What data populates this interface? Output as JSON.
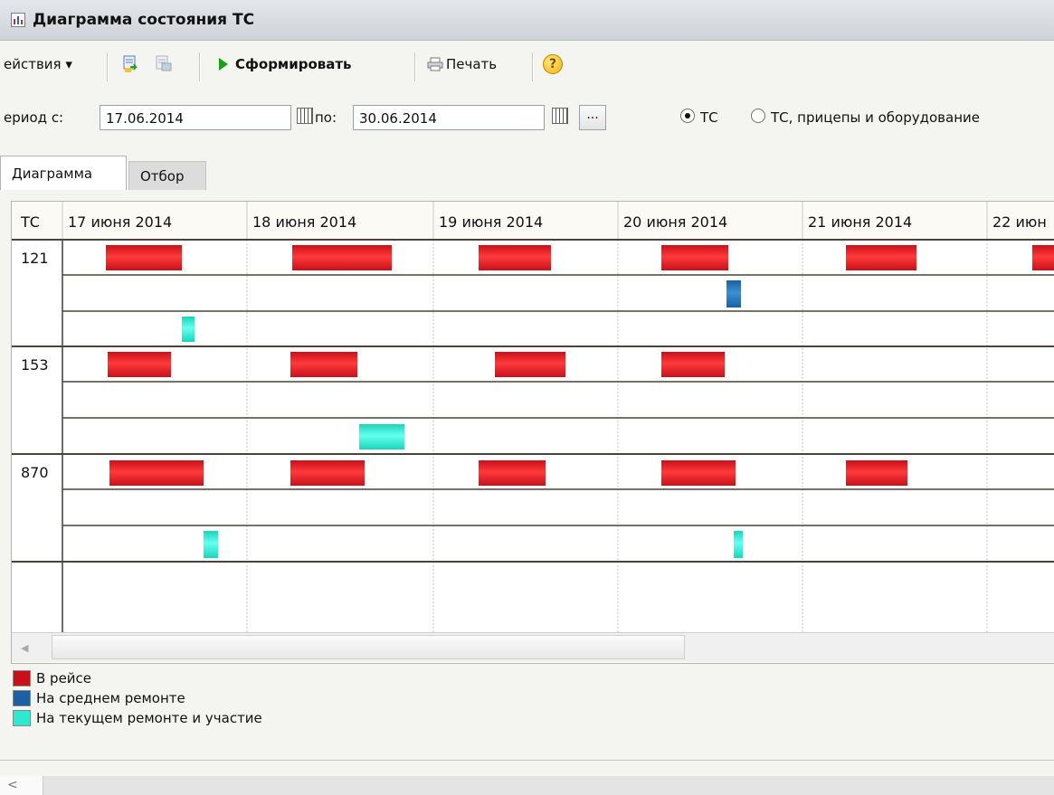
{
  "window": {
    "title": "Диаграмма состояния ТС"
  },
  "toolbar": {
    "actions_label": "ействия ▾",
    "generate_label": "Сформировать",
    "print_label": "Печать",
    "help_label": "?"
  },
  "period": {
    "from_label": "ериод с:",
    "from_value": "17.06.2014",
    "to_label": "по:",
    "to_value": "30.06.2014",
    "more_label": "...",
    "radio_ts_label": "ТС",
    "radio_all_label": "ТС, прицепы и оборудование",
    "radio_selected": "ТС"
  },
  "tabs": [
    {
      "label": "Диаграмма",
      "active": true
    },
    {
      "label": "Отбор",
      "active": false
    }
  ],
  "chart": {
    "ts_header": "ТС",
    "days": [
      "17 июня 2014",
      "18 июня 2014",
      "19 июня 2014",
      "20 июня 2014",
      "21 июня 2014",
      "22 июн"
    ],
    "vehicles": [
      "121",
      "153",
      "870"
    ]
  },
  "legend": [
    {
      "label": "В рейсе",
      "color": "#c8101a"
    },
    {
      "label": "На среднем ремонте",
      "color": "#1c5fa3"
    },
    {
      "label": "На текущем ремонте и участие",
      "color": "#2ee8d0"
    }
  ],
  "colors": {
    "trip": "#c8101a",
    "medium_repair": "#1c5fa3",
    "current_repair": "#2ee8d0"
  }
}
